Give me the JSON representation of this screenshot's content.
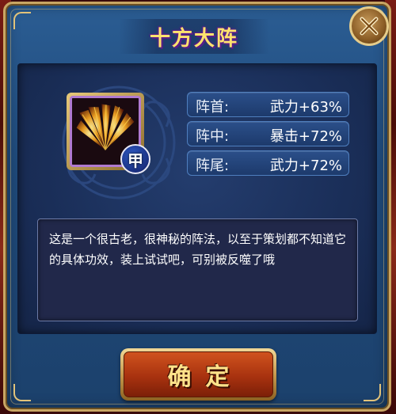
{
  "dialog": {
    "title": "十方大阵",
    "close_icon": "close-x-icon"
  },
  "skill": {
    "icon": "fan-blades-icon",
    "grade": "甲",
    "accent_color": "#b07ad0"
  },
  "stats": [
    {
      "label": "阵首:",
      "value": "武力+63%"
    },
    {
      "label": "阵中:",
      "value": "暴击+72%"
    },
    {
      "label": "阵尾:",
      "value": "武力+72%"
    }
  ],
  "description": "这是一个很古老，很神秘的阵法，以至于策划都不知道它的具体功效，装上试试吧，可别被反噬了哦",
  "confirm_button": {
    "label": "确定"
  }
}
